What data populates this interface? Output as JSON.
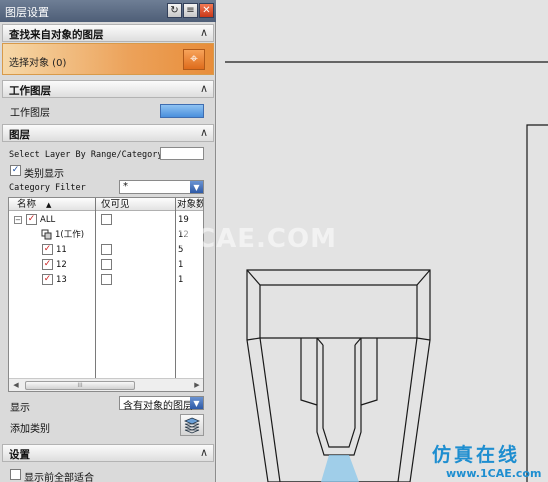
{
  "window": {
    "title": "图层设置"
  },
  "sections": {
    "find": {
      "title": "查找来自对象的图层",
      "select_label": "选择对象 (0)"
    },
    "work": {
      "title": "工作图层",
      "field_label": "工作图层"
    },
    "layers": {
      "title": "图层",
      "range_label": "Select Layer By Range/Category",
      "category_display_label": "类别显示",
      "category_filter_label": "Category Filter",
      "category_filter_value": "*",
      "columns": [
        "名称",
        "仅可见",
        "对象数"
      ],
      "rows": [
        {
          "name": "ALL",
          "count": "19"
        },
        {
          "name": "1(工作)",
          "count": "12"
        },
        {
          "name": "11",
          "count": "5"
        },
        {
          "name": "12",
          "count": "1"
        },
        {
          "name": "13",
          "count": "1"
        }
      ],
      "scroll_thumb_grip": "III",
      "display_label": "显示",
      "display_value": "含有对象的图层",
      "add_category_label": "添加类别"
    },
    "settings": {
      "title": "设置",
      "fit_label": "显示前全部适合"
    }
  },
  "icons": {
    "refresh": "refresh-icon",
    "menu": "menu-icon",
    "close": "close-icon",
    "collapse": "chevron-up-icon",
    "crosshair": "crosshair-icon",
    "layer_stack": "layer-stack-icon",
    "layer": "layer-icon"
  },
  "colors": {
    "title_bar": "#4e5e77",
    "selection_highlight": "#e88d3a",
    "work_layer_field": "#4a8fdc",
    "checkmark": "#c22222",
    "brand": "#1e8ed0"
  },
  "watermark": {
    "text": "1CAE.COM"
  },
  "brand": {
    "name": "仿真在线",
    "url": "www.1CAE.com"
  }
}
